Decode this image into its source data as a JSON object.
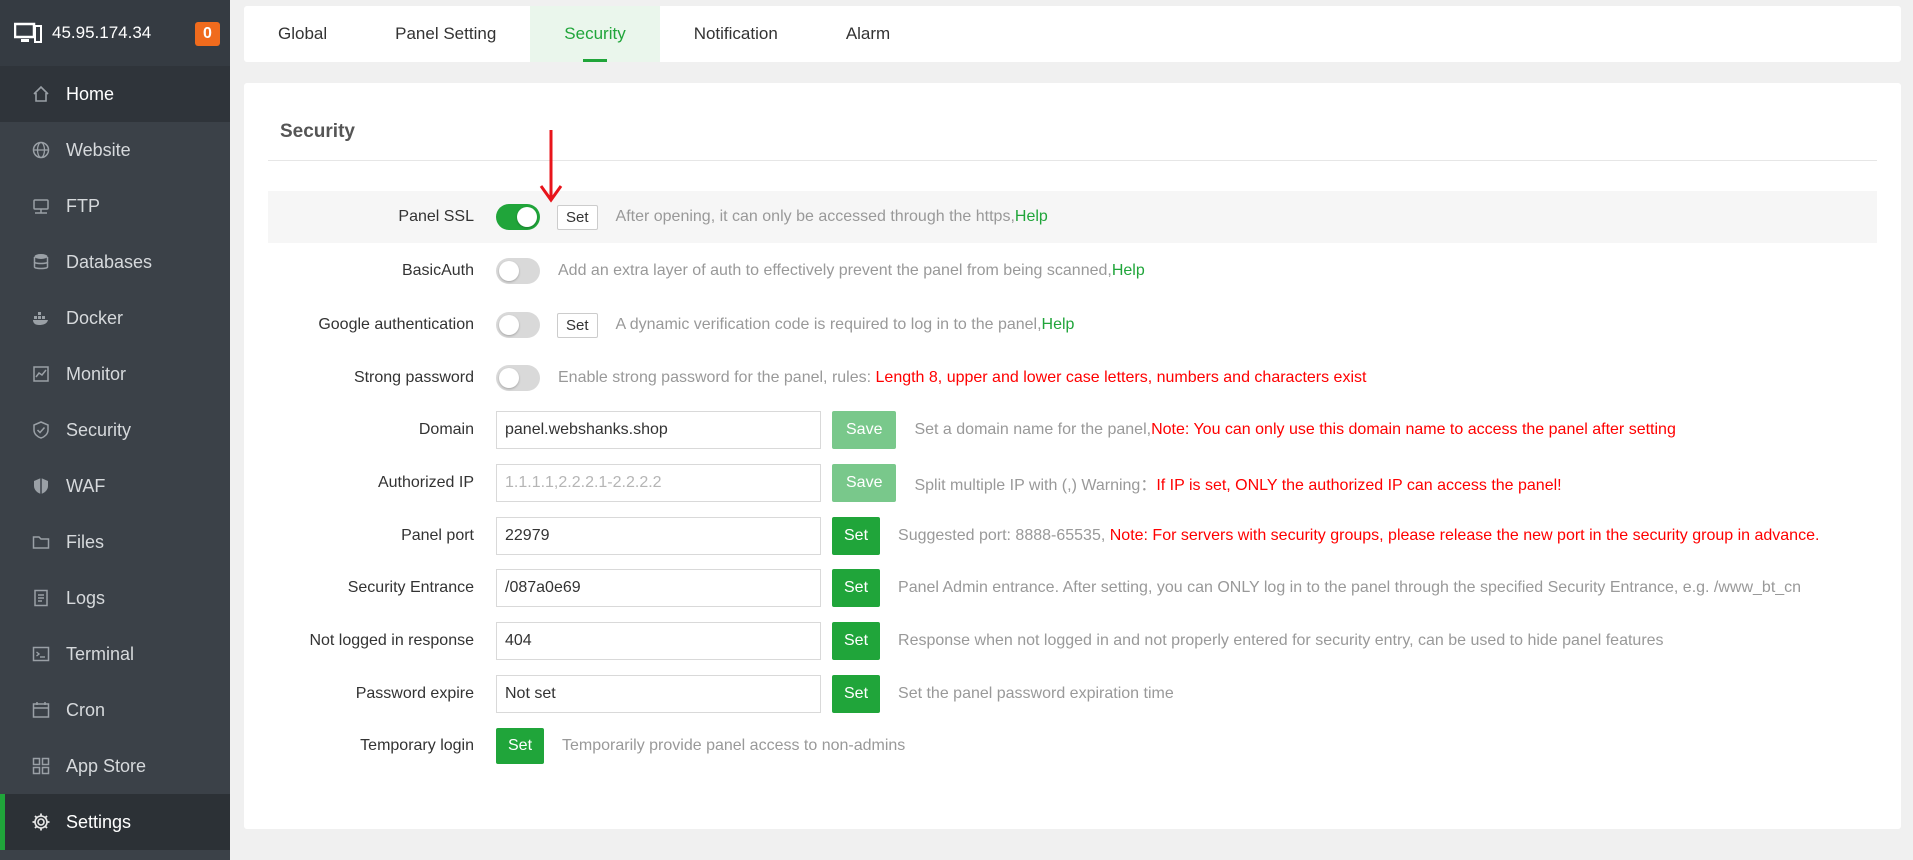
{
  "header": {
    "ip": "45.95.174.34",
    "badge": "0"
  },
  "sidebar": {
    "items": [
      {
        "label": "Home",
        "icon": "home-icon"
      },
      {
        "label": "Website",
        "icon": "globe-icon"
      },
      {
        "label": "FTP",
        "icon": "ftp-icon"
      },
      {
        "label": "Databases",
        "icon": "database-icon"
      },
      {
        "label": "Docker",
        "icon": "docker-icon"
      },
      {
        "label": "Monitor",
        "icon": "monitor-icon"
      },
      {
        "label": "Security",
        "icon": "shield-icon"
      },
      {
        "label": "WAF",
        "icon": "waf-shield-icon"
      },
      {
        "label": "Files",
        "icon": "folder-icon"
      },
      {
        "label": "Logs",
        "icon": "logs-icon"
      },
      {
        "label": "Terminal",
        "icon": "terminal-icon"
      },
      {
        "label": "Cron",
        "icon": "calendar-icon"
      },
      {
        "label": "App Store",
        "icon": "grid-icon"
      },
      {
        "label": "Settings",
        "icon": "gear-icon"
      }
    ]
  },
  "tabs": [
    "Global",
    "Panel Setting",
    "Security",
    "Notification",
    "Alarm"
  ],
  "active_tab": "Security",
  "section": {
    "title": "Security"
  },
  "rows": {
    "panel_ssl": {
      "label": "Panel SSL",
      "enabled": true,
      "set_label": "Set",
      "desc": "After opening, it can only be accessed through the https,",
      "help": "Help"
    },
    "basic_auth": {
      "label": "BasicAuth",
      "enabled": false,
      "desc": "Add an extra layer of auth to effectively prevent the panel from being scanned,",
      "help": "Help"
    },
    "google_auth": {
      "label": "Google authentication",
      "enabled": false,
      "set_label": "Set",
      "desc": "A dynamic verification code is required to log in to the panel,",
      "help": "Help"
    },
    "strong_password": {
      "label": "Strong password",
      "enabled": false,
      "desc": "Enable strong password for the panel, rules: ",
      "rule": "Length 8, upper and lower case letters, numbers and characters exist"
    },
    "domain": {
      "label": "Domain",
      "value": "panel.webshanks.shop",
      "button": "Save",
      "desc": "Set a domain name for the panel,",
      "note": "Note: You can only use this domain name to access the panel after setting"
    },
    "authorized_ip": {
      "label": "Authorized IP",
      "value": "",
      "placeholder": "1.1.1.1,2.2.2.1-2.2.2.2",
      "button": "Save",
      "desc": "Split multiple IP with (,) Warning：",
      "note": "If IP is set, ONLY the authorized IP can access the panel!"
    },
    "panel_port": {
      "label": "Panel port",
      "value": "22979",
      "button": "Set",
      "desc": "Suggested port: 8888-65535, ",
      "note": "Note: For servers with security groups, please release the new port in the security group in advance."
    },
    "security_entrance": {
      "label": "Security Entrance",
      "value": "/087a0e69",
      "button": "Set",
      "desc": "Panel Admin entrance. After setting, you can ONLY log in to the panel through the specified Security Entrance, e.g. /www_bt_cn"
    },
    "not_logged_response": {
      "label": "Not logged in response",
      "value": "404",
      "button": "Set",
      "desc": "Response when not logged in and not properly entered for security entry, can be used to hide panel features"
    },
    "password_expire": {
      "label": "Password expire",
      "value": "Not set",
      "button": "Set",
      "desc": "Set the panel password expiration time"
    },
    "temporary_login": {
      "label": "Temporary login",
      "button": "Set",
      "desc": "Temporarily provide panel access to non-admins"
    }
  },
  "colors": {
    "accent": "#20a53a",
    "warning": "#ff0000",
    "sidebar": "#3b4148",
    "annotation_arrow": "#e8141b"
  }
}
